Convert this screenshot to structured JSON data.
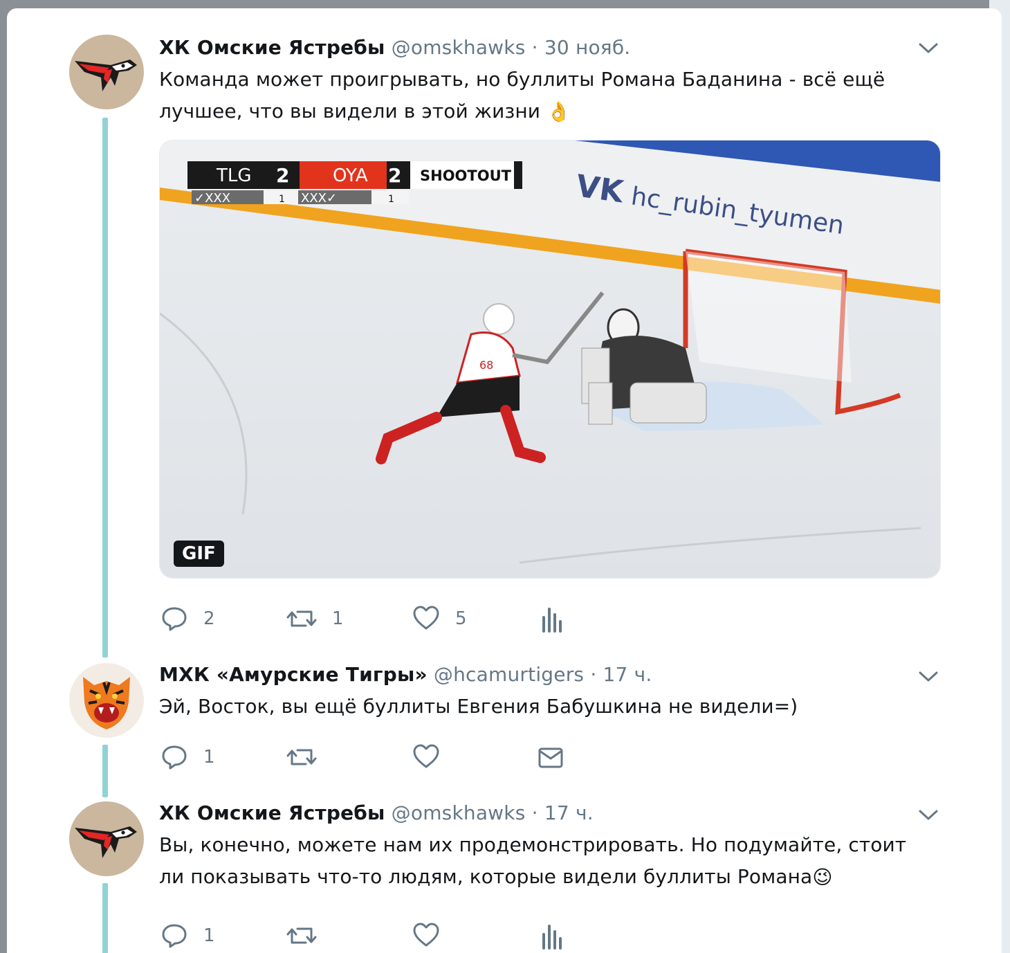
{
  "tweets": [
    {
      "name": "ХК Омские Ястребы",
      "handle": "@omskhawks",
      "dot": "·",
      "time": "30 нояб.",
      "text": "Команда может проигрывать, но буллиты Романа Баданина - всё ещё лучшее, что вы видели в этой жизни",
      "emoji": "👌",
      "media": {
        "badge": "GIF",
        "scoreboard": {
          "home_team": "TLG",
          "home_score": "2",
          "away_team": "OYA",
          "away_score": "2",
          "mode": "SHOOTOUT",
          "home_attempts": "✓XXX",
          "home_goals": "1",
          "away_attempts": "XXX✓",
          "away_goals": "1"
        },
        "board_ad": "hc_rubin_tyumen",
        "jersey_number": "68"
      },
      "actions": {
        "reply_count": "2",
        "retweet_count": "1",
        "like_count": "5"
      }
    },
    {
      "name": "МХК «Амурские Тигры»",
      "handle": "@hcamurtigers",
      "dot": "·",
      "time": "17 ч.",
      "text": "Эй, Восток, вы ещё буллиты Евгения Бабушкина не видели=)",
      "actions": {
        "reply_count": "1",
        "retweet_count": "",
        "like_count": ""
      }
    },
    {
      "name": "ХК Омские Ястребы",
      "handle": "@omskhawks",
      "dot": "·",
      "time": "17 ч.",
      "text": "Вы, конечно, можете нам их продемонстрировать. Но подумайте, стоит ли показывать что-то людям, которые видели буллиты Романа",
      "emoji": "😉",
      "actions": {
        "reply_count": "1",
        "retweet_count": "",
        "like_count": ""
      }
    }
  ],
  "icons": {
    "reply": "reply-icon",
    "retweet": "retweet-icon",
    "like": "heart-icon",
    "analytics": "analytics-icon",
    "dm": "envelope-icon",
    "more": "chevron-down-icon"
  },
  "colors": {
    "thread_line": "#8fd3d6",
    "text": "#14171a",
    "muted": "#657786"
  }
}
